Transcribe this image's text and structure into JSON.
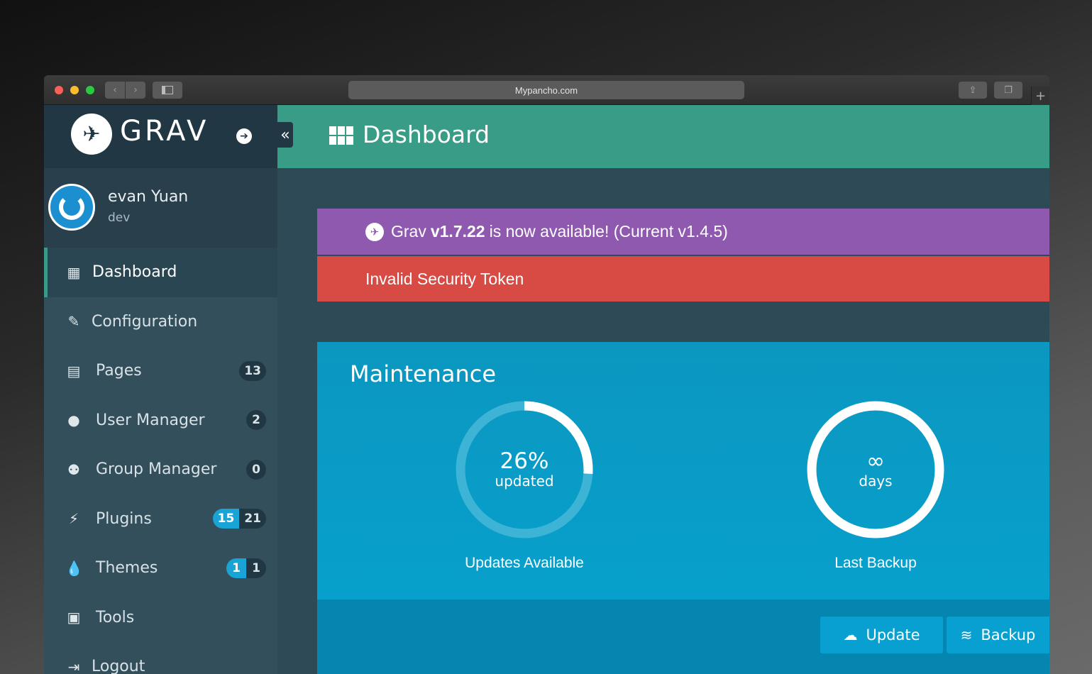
{
  "browser": {
    "url": "Mypancho.com",
    "plus": "+"
  },
  "sidebar": {
    "logo_text": "GRAV",
    "user_name": "evan Yuan",
    "user_role": "dev",
    "items": [
      {
        "label": "Dashboard",
        "icon": "grid-icon",
        "active": true
      },
      {
        "label": "Configuration",
        "icon": "wrench-icon"
      },
      {
        "label": "Pages",
        "icon": "file-icon",
        "badge": "13"
      },
      {
        "label": "User Manager",
        "icon": "user-icon",
        "badge": "2"
      },
      {
        "label": "Group Manager",
        "icon": "users-icon",
        "badge": "0"
      },
      {
        "label": "Plugins",
        "icon": "plug-icon",
        "badge_updates": "15",
        "badge": "21"
      },
      {
        "label": "Themes",
        "icon": "tint-icon",
        "badge_updates": "1",
        "badge": "1"
      },
      {
        "label": "Tools",
        "icon": "briefcase-icon"
      },
      {
        "label": "Logout",
        "icon": "sign-out-icon"
      }
    ]
  },
  "header": {
    "title": "Dashboard"
  },
  "alerts": {
    "update_prefix": "Grav",
    "update_version": "v1.7.22",
    "update_suffix": "is now available! (Current v1.4.5)",
    "error": "Invalid Security Token"
  },
  "maintenance": {
    "title": "Maintenance",
    "updates_percent": 26,
    "updates_value": "26%",
    "updates_sub": "updated",
    "updates_label": "Updates Available",
    "backup_value": "∞",
    "backup_sub": "days",
    "backup_label": "Last Backup",
    "update_button": "Update",
    "backup_button": "Backup"
  },
  "colors": {
    "topbar": "#389c86",
    "alert_purple": "#8f59b0",
    "alert_red": "#d84b44",
    "maintenance": "#0a9ac3"
  }
}
